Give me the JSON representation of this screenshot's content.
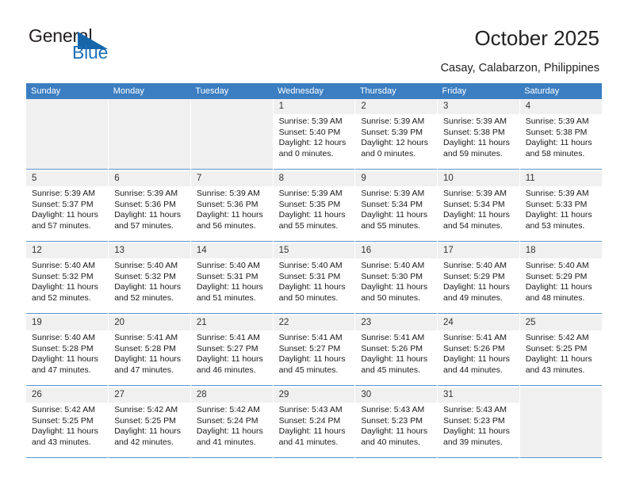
{
  "brand": {
    "name_part1": "General",
    "name_part2": "Blue",
    "accent_color": "#1d70b8",
    "triangle_icon": "triangle-icon"
  },
  "header": {
    "title": "October 2025",
    "subtitle": "Casay, Calabarzon, Philippines"
  },
  "calendar": {
    "header_bg": "#3b7ec1",
    "weekdays": [
      "Sunday",
      "Monday",
      "Tuesday",
      "Wednesday",
      "Thursday",
      "Friday",
      "Saturday"
    ],
    "weeks": [
      [
        {
          "day": "",
          "empty": true
        },
        {
          "day": "",
          "empty": true
        },
        {
          "day": "",
          "empty": true
        },
        {
          "day": "1",
          "sunrise": "Sunrise: 5:39 AM",
          "sunset": "Sunset: 5:40 PM",
          "daylight": "Daylight: 12 hours and 0 minutes."
        },
        {
          "day": "2",
          "sunrise": "Sunrise: 5:39 AM",
          "sunset": "Sunset: 5:39 PM",
          "daylight": "Daylight: 12 hours and 0 minutes."
        },
        {
          "day": "3",
          "sunrise": "Sunrise: 5:39 AM",
          "sunset": "Sunset: 5:38 PM",
          "daylight": "Daylight: 11 hours and 59 minutes."
        },
        {
          "day": "4",
          "sunrise": "Sunrise: 5:39 AM",
          "sunset": "Sunset: 5:38 PM",
          "daylight": "Daylight: 11 hours and 58 minutes."
        }
      ],
      [
        {
          "day": "5",
          "sunrise": "Sunrise: 5:39 AM",
          "sunset": "Sunset: 5:37 PM",
          "daylight": "Daylight: 11 hours and 57 minutes."
        },
        {
          "day": "6",
          "sunrise": "Sunrise: 5:39 AM",
          "sunset": "Sunset: 5:36 PM",
          "daylight": "Daylight: 11 hours and 57 minutes."
        },
        {
          "day": "7",
          "sunrise": "Sunrise: 5:39 AM",
          "sunset": "Sunset: 5:36 PM",
          "daylight": "Daylight: 11 hours and 56 minutes."
        },
        {
          "day": "8",
          "sunrise": "Sunrise: 5:39 AM",
          "sunset": "Sunset: 5:35 PM",
          "daylight": "Daylight: 11 hours and 55 minutes."
        },
        {
          "day": "9",
          "sunrise": "Sunrise: 5:39 AM",
          "sunset": "Sunset: 5:34 PM",
          "daylight": "Daylight: 11 hours and 55 minutes."
        },
        {
          "day": "10",
          "sunrise": "Sunrise: 5:39 AM",
          "sunset": "Sunset: 5:34 PM",
          "daylight": "Daylight: 11 hours and 54 minutes."
        },
        {
          "day": "11",
          "sunrise": "Sunrise: 5:39 AM",
          "sunset": "Sunset: 5:33 PM",
          "daylight": "Daylight: 11 hours and 53 minutes."
        }
      ],
      [
        {
          "day": "12",
          "sunrise": "Sunrise: 5:40 AM",
          "sunset": "Sunset: 5:32 PM",
          "daylight": "Daylight: 11 hours and 52 minutes."
        },
        {
          "day": "13",
          "sunrise": "Sunrise: 5:40 AM",
          "sunset": "Sunset: 5:32 PM",
          "daylight": "Daylight: 11 hours and 52 minutes."
        },
        {
          "day": "14",
          "sunrise": "Sunrise: 5:40 AM",
          "sunset": "Sunset: 5:31 PM",
          "daylight": "Daylight: 11 hours and 51 minutes."
        },
        {
          "day": "15",
          "sunrise": "Sunrise: 5:40 AM",
          "sunset": "Sunset: 5:31 PM",
          "daylight": "Daylight: 11 hours and 50 minutes."
        },
        {
          "day": "16",
          "sunrise": "Sunrise: 5:40 AM",
          "sunset": "Sunset: 5:30 PM",
          "daylight": "Daylight: 11 hours and 50 minutes."
        },
        {
          "day": "17",
          "sunrise": "Sunrise: 5:40 AM",
          "sunset": "Sunset: 5:29 PM",
          "daylight": "Daylight: 11 hours and 49 minutes."
        },
        {
          "day": "18",
          "sunrise": "Sunrise: 5:40 AM",
          "sunset": "Sunset: 5:29 PM",
          "daylight": "Daylight: 11 hours and 48 minutes."
        }
      ],
      [
        {
          "day": "19",
          "sunrise": "Sunrise: 5:40 AM",
          "sunset": "Sunset: 5:28 PM",
          "daylight": "Daylight: 11 hours and 47 minutes."
        },
        {
          "day": "20",
          "sunrise": "Sunrise: 5:41 AM",
          "sunset": "Sunset: 5:28 PM",
          "daylight": "Daylight: 11 hours and 47 minutes."
        },
        {
          "day": "21",
          "sunrise": "Sunrise: 5:41 AM",
          "sunset": "Sunset: 5:27 PM",
          "daylight": "Daylight: 11 hours and 46 minutes."
        },
        {
          "day": "22",
          "sunrise": "Sunrise: 5:41 AM",
          "sunset": "Sunset: 5:27 PM",
          "daylight": "Daylight: 11 hours and 45 minutes."
        },
        {
          "day": "23",
          "sunrise": "Sunrise: 5:41 AM",
          "sunset": "Sunset: 5:26 PM",
          "daylight": "Daylight: 11 hours and 45 minutes."
        },
        {
          "day": "24",
          "sunrise": "Sunrise: 5:41 AM",
          "sunset": "Sunset: 5:26 PM",
          "daylight": "Daylight: 11 hours and 44 minutes."
        },
        {
          "day": "25",
          "sunrise": "Sunrise: 5:42 AM",
          "sunset": "Sunset: 5:25 PM",
          "daylight": "Daylight: 11 hours and 43 minutes."
        }
      ],
      [
        {
          "day": "26",
          "sunrise": "Sunrise: 5:42 AM",
          "sunset": "Sunset: 5:25 PM",
          "daylight": "Daylight: 11 hours and 43 minutes."
        },
        {
          "day": "27",
          "sunrise": "Sunrise: 5:42 AM",
          "sunset": "Sunset: 5:25 PM",
          "daylight": "Daylight: 11 hours and 42 minutes."
        },
        {
          "day": "28",
          "sunrise": "Sunrise: 5:42 AM",
          "sunset": "Sunset: 5:24 PM",
          "daylight": "Daylight: 11 hours and 41 minutes."
        },
        {
          "day": "29",
          "sunrise": "Sunrise: 5:43 AM",
          "sunset": "Sunset: 5:24 PM",
          "daylight": "Daylight: 11 hours and 41 minutes."
        },
        {
          "day": "30",
          "sunrise": "Sunrise: 5:43 AM",
          "sunset": "Sunset: 5:23 PM",
          "daylight": "Daylight: 11 hours and 40 minutes."
        },
        {
          "day": "31",
          "sunrise": "Sunrise: 5:43 AM",
          "sunset": "Sunset: 5:23 PM",
          "daylight": "Daylight: 11 hours and 39 minutes."
        },
        {
          "day": "",
          "empty": true
        }
      ]
    ]
  }
}
